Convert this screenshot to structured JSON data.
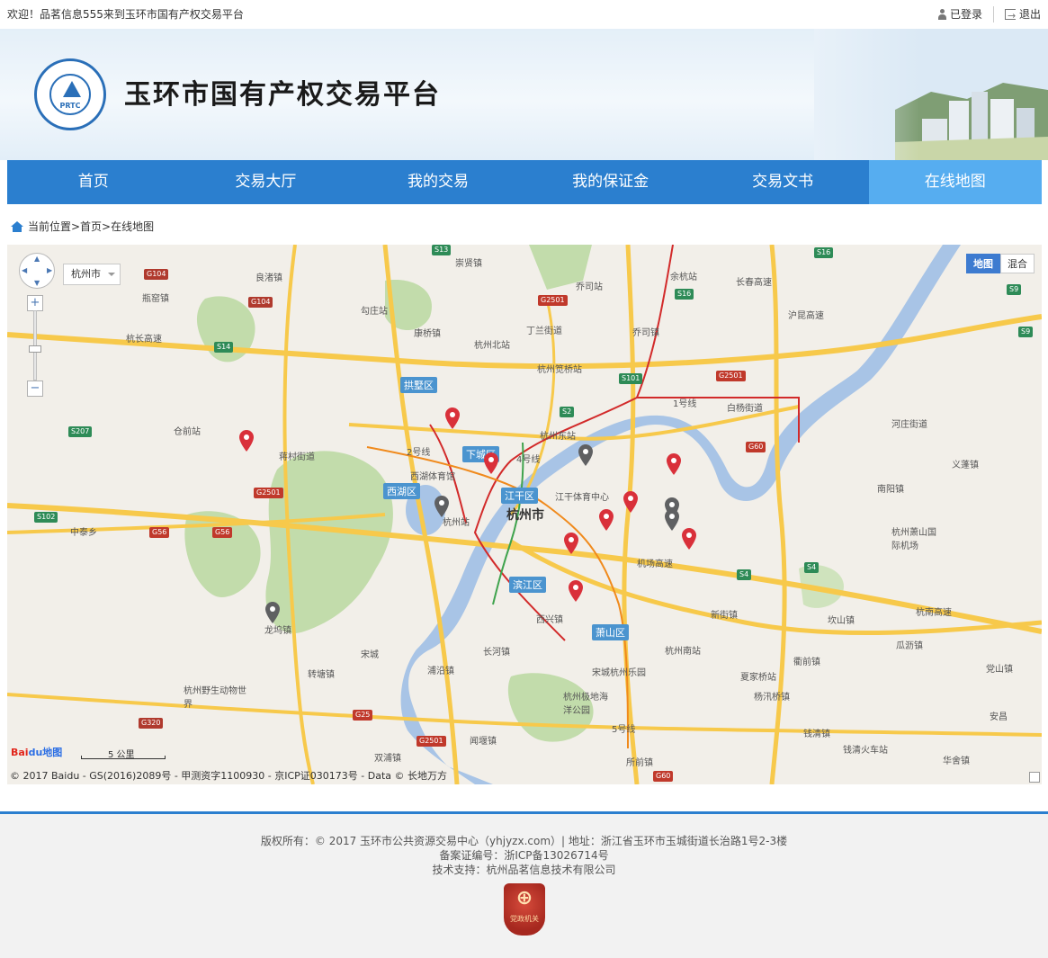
{
  "topbar": {
    "welcome": "欢迎！品茗信息555来到玉环市国有产权交易平台",
    "login": "已登录",
    "logout": "退出"
  },
  "banner": {
    "logo_text": "PRTC",
    "title": "玉环市国有产权交易平台"
  },
  "nav": {
    "items": [
      "首页",
      "交易大厅",
      "我的交易",
      "我的保证金",
      "交易文书",
      "在线地图"
    ],
    "active_index": 5
  },
  "breadcrumb": {
    "text": "当前位置>首页>在线地图"
  },
  "map": {
    "city_select": "杭州市",
    "map_type": {
      "map": "地图",
      "hybrid": "混合",
      "selected": "map"
    },
    "scale_label": "5 公里",
    "baidu_logo": "Bai",
    "baidu_logo_du": "du",
    "baidu_logo_suffix": "地图",
    "copyright": "© 2017 Baidu - GS(2016)2089号 - 甲测资字1100930 - 京ICP证030173号 - Data © 长地万方",
    "districts": [
      "拱墅区",
      "下城区",
      "西湖区",
      "江干区",
      "滨江区",
      "萧山区"
    ],
    "city_name": "杭州市",
    "places": [
      "崇贤镇",
      "良渚镇",
      "瓶窑镇",
      "勾庄站",
      "乔司站",
      "余杭站",
      "乔司镇",
      "丁兰街道",
      "康桥镇",
      "杭州北站",
      "杭州笕桥站",
      "白杨街道",
      "杭州东站",
      "河庄街道",
      "仓前站",
      "蒋村街道",
      "西湖体育馆",
      "江干体育中心",
      "义蓬镇",
      "南阳镇",
      "杭州站",
      "杭州萧山国际机场",
      "中泰乡",
      "机场高速",
      "新街镇",
      "坎山镇",
      "瓜沥镇",
      "西兴镇",
      "龙坞镇",
      "宋城",
      "长河镇",
      "杭州南站",
      "衢前镇",
      "党山镇",
      "转塘镇",
      "浦沿镇",
      "宋城杭州乐园",
      "夏家桥站",
      "杭州野生动物世界",
      "杭州极地海洋公园",
      "杨汛桥镇",
      "安昌",
      "闻堰镇",
      "钱清镇",
      "双浦镇",
      "所前镇",
      "钱清火车站",
      "华舍镇",
      "长春高速",
      "杭南高速",
      "杭长高速",
      "沪昆高速",
      "1号线",
      "2号线",
      "4号线",
      "5号线"
    ],
    "road_shields": [
      "S13",
      "G104",
      "G104",
      "S14",
      "S207",
      "G2501",
      "S102",
      "G56",
      "G56",
      "S16",
      "S16",
      "G2501",
      "S101",
      "S2",
      "G60",
      "S9",
      "S9",
      "S4",
      "S4",
      "G25",
      "G320",
      "G2501",
      "G60",
      "G2501"
    ],
    "marker_colors": {
      "red": "#d9303a",
      "gray": "#5f6062"
    },
    "water_color": "#a8c4e6",
    "green_color": "#c2dcab",
    "road_color": "#f7c94b"
  },
  "footer": {
    "line1": "版权所有：© 2017 玉环市公共资源交易中心（yhjyzx.com）| 地址：浙江省玉环市玉城街道长治路1号2-3楼",
    "line2": "备案证编号：浙ICP备13026714号",
    "line3": "技术支持：杭州品茗信息技术有限公司",
    "badge_text": "党政机关"
  }
}
